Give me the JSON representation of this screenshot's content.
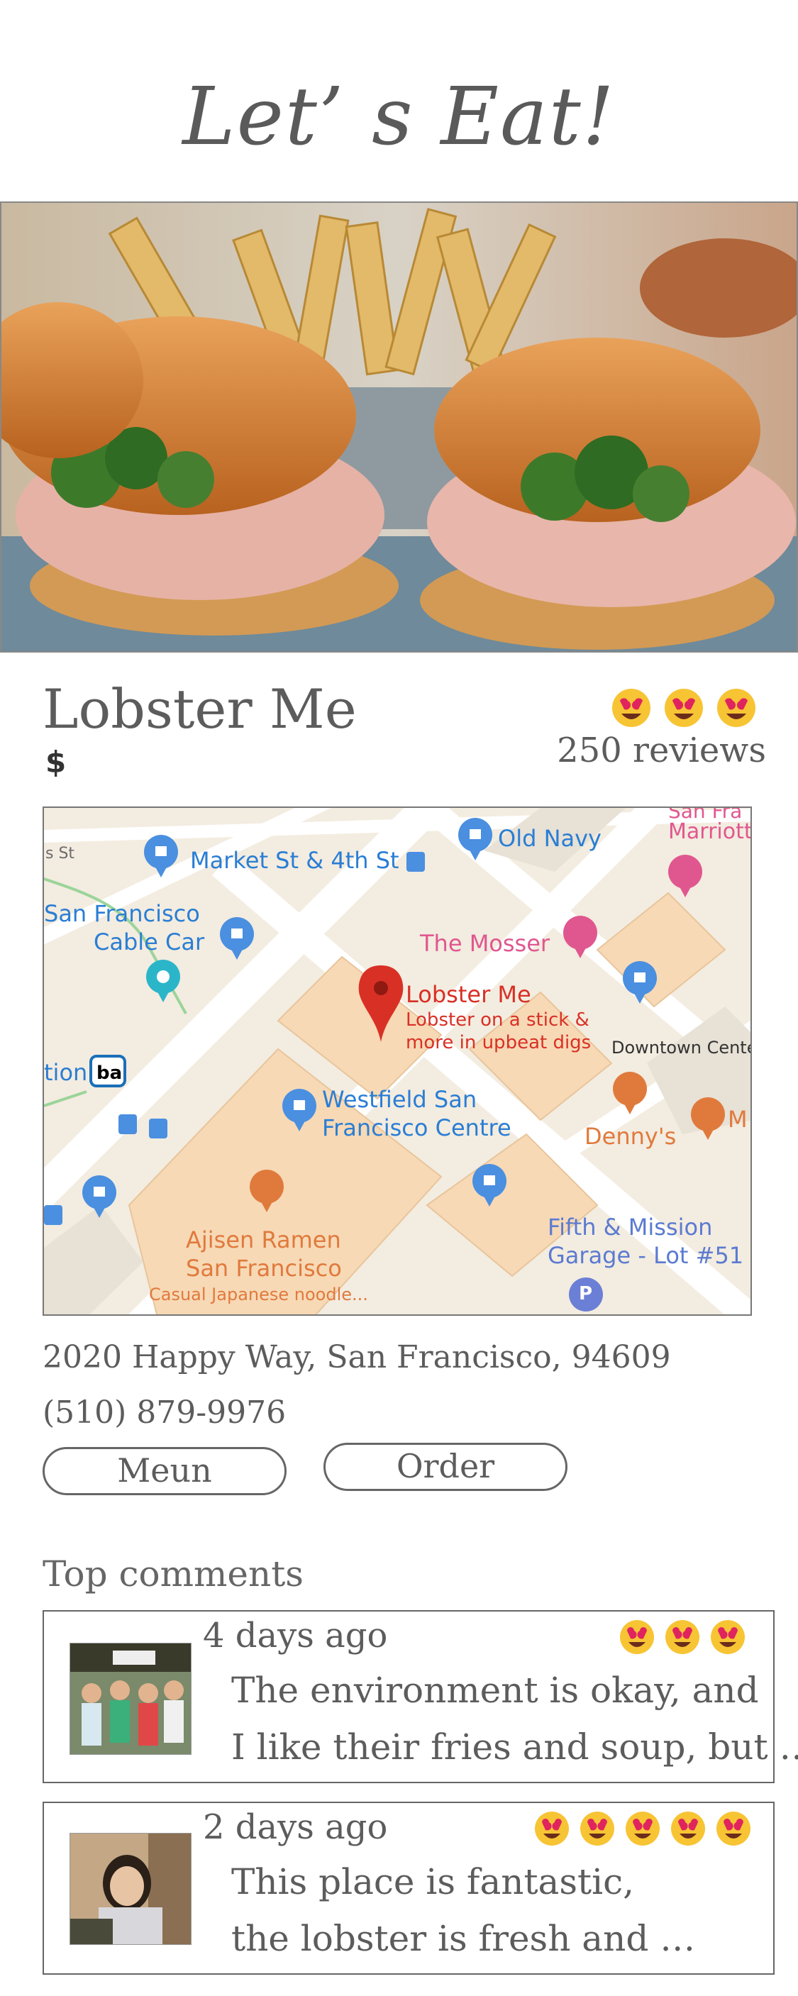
{
  "app": {
    "title": "Let’ s Eat!"
  },
  "restaurant": {
    "name": "Lobster Me",
    "price": "$",
    "rating_icons": [
      "heart-eyes-emoji",
      "heart-eyes-emoji",
      "heart-eyes-emoji"
    ],
    "reviews": "250 reviews",
    "address": "2020 Happy Way, San Francisco, 94609",
    "phone": "(510) 879-9976"
  },
  "map": {
    "labels": {
      "st": "s St",
      "market": "Market St & 4th St",
      "old_navy": "Old Navy",
      "marriott_top": "San Fra",
      "marriott": "Marriott",
      "sf_cable_car_1": "San Francisco",
      "sf_cable_car_2": "Cable Car",
      "mosser": "The Mosser",
      "pin_title": "Lobster Me",
      "pin_desc_1": "Lobster on a stick &",
      "pin_desc_2": "more in upbeat digs",
      "downtown": "Downtown Center",
      "station": "tion",
      "westfield_1": "Westfield San",
      "westfield_2": "Francisco Centre",
      "dennys": "Denny's",
      "m": "M",
      "ajisen_1": "Ajisen Ramen",
      "ajisen_2": "San Francisco",
      "ajisen_3": "Casual Japanese noodle...",
      "garage_1": "Fifth & Mission",
      "garage_2": "Garage - Lot #51",
      "parking": "P"
    }
  },
  "buttons": {
    "menu": "Meun",
    "order": "Order"
  },
  "comments_section": {
    "title": "Top comments",
    "comments": [
      {
        "time": "4 days ago",
        "rating": 3,
        "line1": "The environment is okay,  and",
        "line2": "I like their fries and soup, but …"
      },
      {
        "time": "2 days ago",
        "rating": 5,
        "line1": "This place is fantastic,",
        "line2": "the lobster is fresh and …"
      }
    ]
  },
  "colors": {
    "text": "#5c5c5c",
    "map_bg": "#f3ece0",
    "map_pin": "#d93025",
    "map_blue": "#4a8fe0",
    "map_orange": "#e07a3c",
    "map_pink": "#e0578f"
  }
}
